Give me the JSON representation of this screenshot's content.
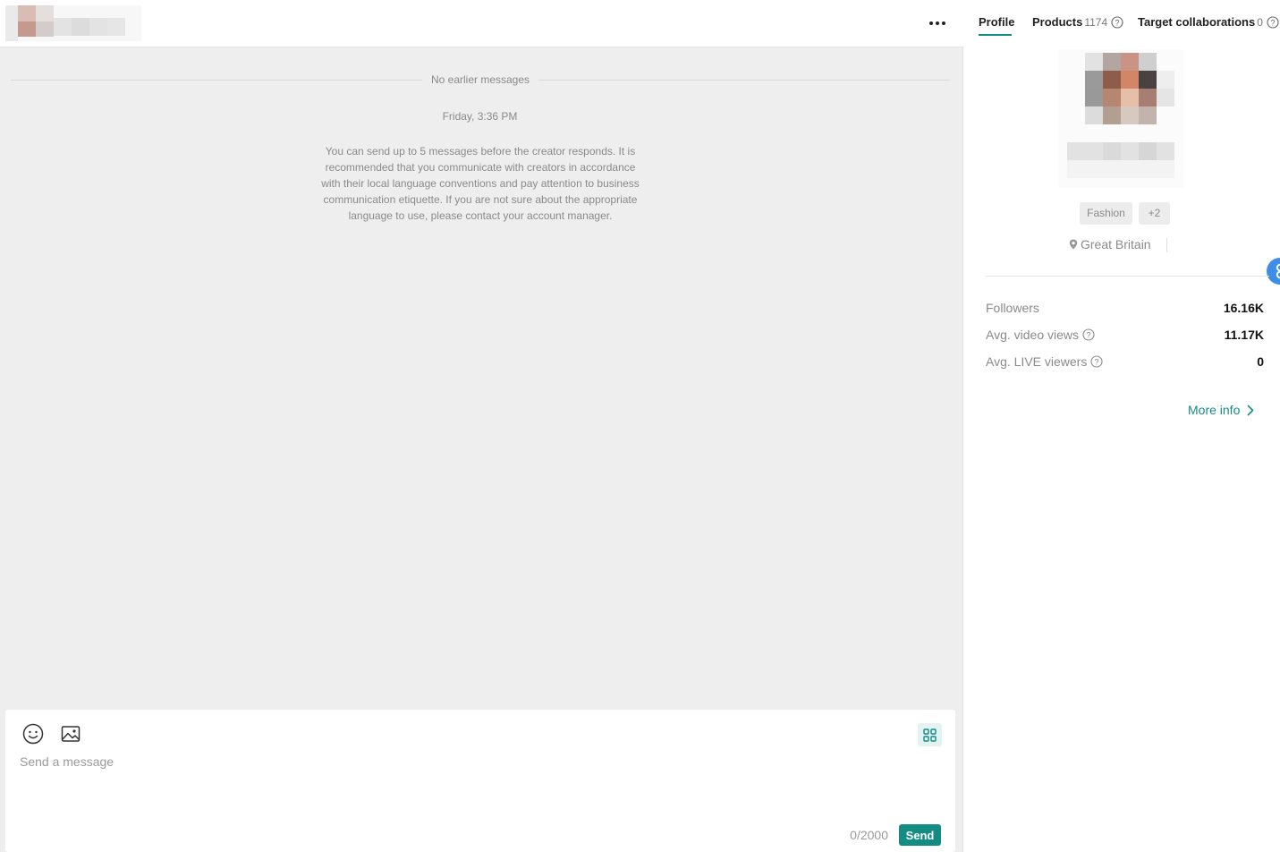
{
  "chat": {
    "divider_text": "No earlier messages",
    "timestamp": "Friday, 3:36 PM",
    "notice": "You can send up to 5 messages before the creator responds. It is recommended that you communicate with creators in accordance with their local language conventions and pay attention to business communication etiquette. If you are not sure about the appropriate language to use, please contact your account manager."
  },
  "composer": {
    "placeholder": "Send a message",
    "counter": "0/2000",
    "send_label": "Send"
  },
  "tabs": {
    "profile": "Profile",
    "products": "Products",
    "products_count": "1174",
    "target": "Target collaborations",
    "target_count": "0"
  },
  "profile": {
    "tags": [
      "Fashion",
      "+2"
    ],
    "location": "Great Britain"
  },
  "stats": [
    {
      "label": "Followers",
      "value": "16.16K"
    },
    {
      "label": "Avg. video views",
      "value": "11.17K"
    },
    {
      "label": "Avg. LIVE viewers",
      "value": "0"
    }
  ],
  "more_info": "More info",
  "colors": {
    "accent": "#138c84",
    "panel_bg": "#eeeeee"
  },
  "icons": [
    "more-icon",
    "emoji-icon",
    "image-icon",
    "grid-icon",
    "help-icon",
    "location-pin-icon",
    "chevron-right-icon"
  ]
}
